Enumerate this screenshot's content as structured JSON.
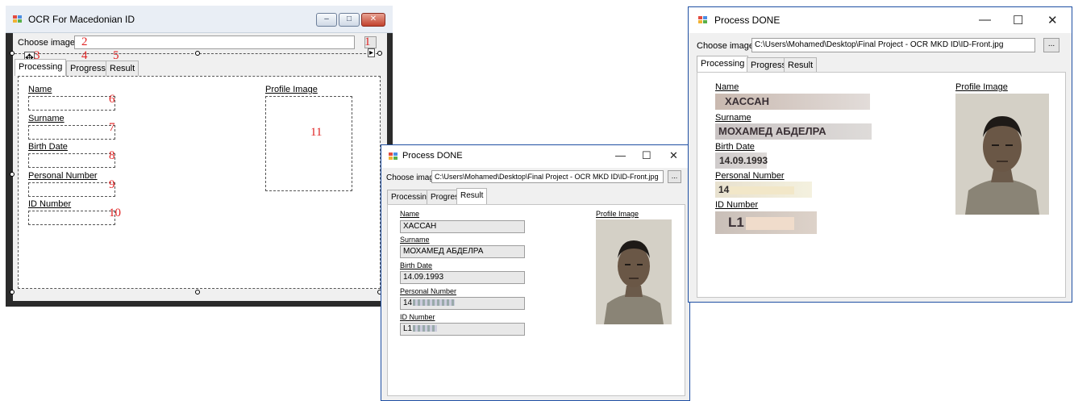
{
  "designer": {
    "title": "OCR For Macedonian ID",
    "choose_label": "Choose image",
    "tabs": [
      "Processing",
      "Progress",
      "Result"
    ],
    "fields": [
      "Name",
      "Surname",
      "Birth Date",
      "Personal Number",
      "ID Number"
    ],
    "profile_label": "Profile Image",
    "browse_label": "...",
    "min_glyph": "–",
    "max_glyph": "□",
    "close_glyph": "✕",
    "markers": [
      "1",
      "2",
      "3",
      "4",
      "5",
      "6",
      "7",
      "8",
      "9",
      "10",
      "11"
    ],
    "move_glyph": "✥",
    "collapse_glyph": "▸"
  },
  "result_window": {
    "title": "Process DONE",
    "choose_label": "Choose image",
    "path": "C:\\Users\\Mohamed\\Desktop\\Final Project - OCR MKD ID\\ID-Front.jpg",
    "browse_label": "...",
    "tabs": [
      "Processing",
      "Progress",
      "Result"
    ],
    "active_tab": "Result",
    "fields": [
      {
        "label": "Name",
        "value": "ХАССАН"
      },
      {
        "label": "Surname",
        "value": "МОХАМЕД АБДЕЛРА"
      },
      {
        "label": "Birth Date",
        "value": "14.09.1993"
      },
      {
        "label": "Personal Number",
        "value": "14"
      },
      {
        "label": "ID Number",
        "value": "L1"
      }
    ],
    "profile_label": "Profile Image",
    "min_glyph": "—",
    "max_glyph": "☐",
    "close_glyph": "✕"
  },
  "processing_window": {
    "title": "Process DONE",
    "choose_label": "Choose image",
    "path": "C:\\Users\\Mohamed\\Desktop\\Final Project - OCR MKD ID\\ID-Front.jpg",
    "browse_label": "...",
    "tabs": [
      "Processing",
      "Progress",
      "Result"
    ],
    "active_tab": "Processing",
    "fields": [
      {
        "label": "Name",
        "value": "ХАССАН"
      },
      {
        "label": "Surname",
        "value": "МОХАМЕД АБДЕЛРА"
      },
      {
        "label": "Birth Date",
        "value": "14.09.1993"
      },
      {
        "label": "Personal Number",
        "value": "14"
      },
      {
        "label": "ID Number",
        "value": "L1"
      }
    ],
    "profile_label": "Profile Image",
    "min_glyph": "—",
    "max_glyph": "☐",
    "close_glyph": "✕"
  },
  "colors": {
    "marker": "#e02424",
    "win_border": "#1f4fa3",
    "designer_frame": "#2b2b2b"
  }
}
